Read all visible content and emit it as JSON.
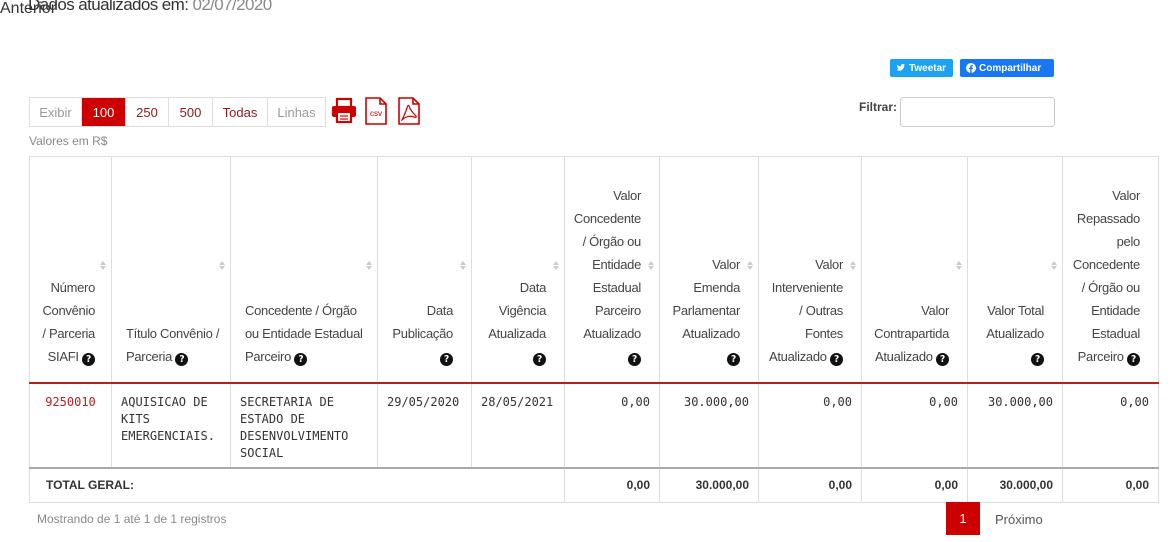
{
  "header": {
    "updated_label": "Dados atualizados em:",
    "updated_date": "02/07/2020"
  },
  "share": {
    "tweet": "Tweetar",
    "facebook": "Compartilhar"
  },
  "toolbar": {
    "show_label": "Exibir",
    "options": [
      "100",
      "250",
      "500",
      "Todas"
    ],
    "active_option": "100",
    "lines_label": "Linhas",
    "export_icons": [
      "print-icon",
      "csv-icon",
      "pdf-icon"
    ],
    "csv_text": "csv",
    "filter_label": "Filtrar:",
    "filter_value": ""
  },
  "valores_label": "Valores em R$",
  "table": {
    "headers": [
      "Número Convênio / Parceria SIAFI",
      "Título Convênio / Parceria",
      "Concedente / Órgão ou Entidade Estadual Parceiro",
      "Data Publicação",
      "Data Vigência Atualizada",
      "Valor Concedente / Órgão ou Entidade Estadual Parceiro Atualizado",
      "Valor Emenda Parlamentar Atualizado",
      "Valor Interveniente / Outras Fontes Atualizado",
      "Valor Contrapartida Atualizado",
      "Valor Total Atualizado",
      "Valor Repassado pelo Concedente / Órgão ou Entidade Estadual Parceiro"
    ],
    "rows": [
      [
        "9250010",
        "AQUISICAO DE KITS EMERGENCIAIS.",
        "SECRETARIA DE ESTADO DE DESENVOLVIMENTO SOCIAL",
        "29/05/2020",
        "28/05/2021",
        "0,00",
        "30.000,00",
        "0,00",
        "0,00",
        "30.000,00",
        "0,00"
      ]
    ],
    "footer": {
      "label": "TOTAL GERAL:",
      "totals": [
        "0,00",
        "30.000,00",
        "0,00",
        "0,00",
        "30.000,00",
        "0,00"
      ]
    }
  },
  "pagination": {
    "info": "Mostrando de 1 até 1 de 1 registros",
    "prev": "Anterior",
    "current": "1",
    "next": "Próximo"
  },
  "colors": {
    "accent": "#cc0000",
    "twitter": "#1da1f2",
    "facebook": "#1877f2"
  }
}
